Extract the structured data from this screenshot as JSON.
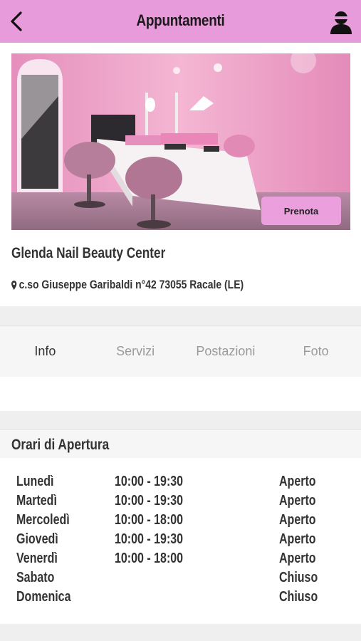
{
  "header": {
    "title": "Appuntamenti",
    "back_icon": "chevron-left-icon",
    "profile_icon": "user-avatar-icon",
    "background_color": "#e89bdb"
  },
  "salon": {
    "photo_description_icon": "salon-photo",
    "book_label": "Prenota",
    "name": "Glenda Nail Beauty Center",
    "address_icon": "map-pin-icon",
    "address": "c.so Giuseppe Garibaldi n°42 73055 Racale (LE)"
  },
  "tabs": [
    {
      "label": "Info",
      "active": true
    },
    {
      "label": "Servizi",
      "active": false
    },
    {
      "label": "Postazioni",
      "active": false
    },
    {
      "label": "Foto",
      "active": false
    }
  ],
  "opening_hours": {
    "title": "Orari di Apertura",
    "rows": [
      {
        "day": "Lunedì",
        "time": "10:00 - 19:30",
        "status": "Aperto"
      },
      {
        "day": "Martedì",
        "time": "10:00 - 19:30",
        "status": "Aperto"
      },
      {
        "day": "Mercoledì",
        "time": "10:00 - 18:00",
        "status": "Aperto"
      },
      {
        "day": "Giovedì",
        "time": "10:00 - 19:30",
        "status": "Aperto"
      },
      {
        "day": "Venerdì",
        "time": "10:00 - 18:00",
        "status": "Aperto"
      },
      {
        "day": "Sabato",
        "time": "",
        "status": "Chiuso"
      },
      {
        "day": "Domenica",
        "time": "",
        "status": "Chiuso"
      }
    ]
  }
}
